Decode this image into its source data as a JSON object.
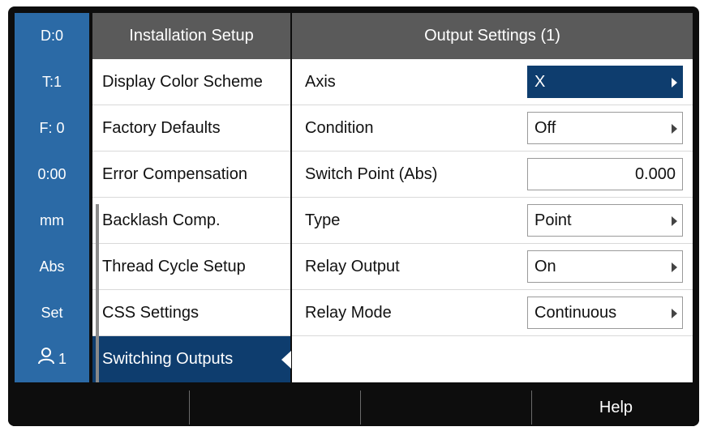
{
  "status_bar": {
    "items": [
      "D:0",
      "T:1",
      "F:  0",
      "0:00",
      "mm",
      "Abs",
      "Set"
    ],
    "user_label": "1"
  },
  "menu": {
    "title": "Installation Setup",
    "items": [
      "Display Color Scheme",
      "Factory Defaults",
      "Error Compensation",
      "Backlash Comp.",
      "Thread Cycle Setup",
      "CSS Settings",
      "Switching Outputs"
    ],
    "selected": "Switching Outputs"
  },
  "settings": {
    "title": "Output Settings (1)",
    "rows": [
      {
        "label": "Axis",
        "value": "X"
      },
      {
        "label": "Condition",
        "value": "Off"
      },
      {
        "label": "Switch Point (Abs)",
        "value": "0.000"
      },
      {
        "label": "Type",
        "value": "Point"
      },
      {
        "label": "Relay Output",
        "value": "On"
      },
      {
        "label": "Relay Mode",
        "value": "Continuous"
      }
    ]
  },
  "softkeys": [
    "",
    "",
    "",
    "Help"
  ],
  "colors": {
    "status_blue": "#2b6aa6",
    "header_gray": "#5a5a5a",
    "selected_navy": "#0e3d6e",
    "frame_black": "#0d0d0d"
  }
}
